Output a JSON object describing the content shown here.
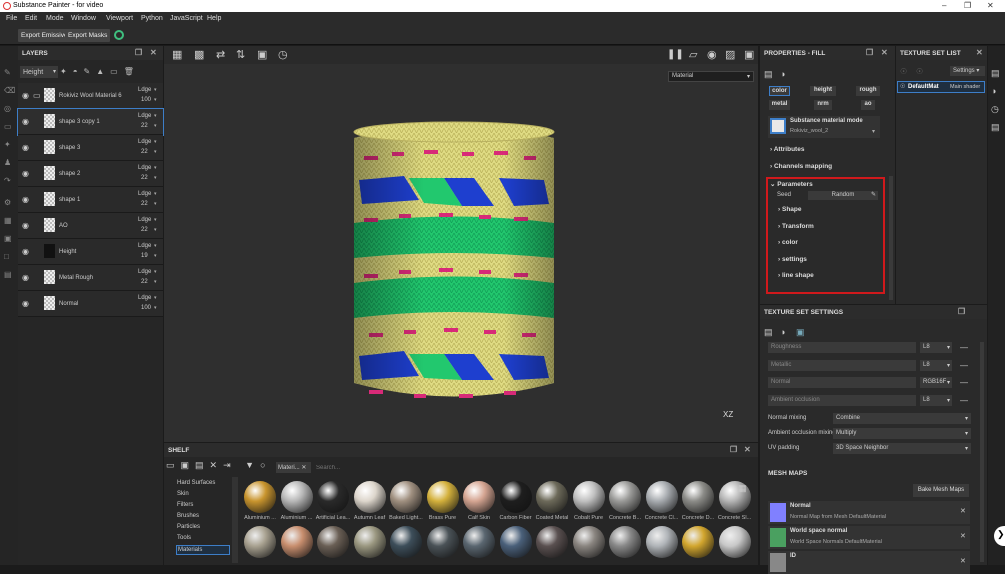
{
  "window": {
    "title": "Substance Painter - for video"
  },
  "menu": [
    "File",
    "Edit",
    "Mode",
    "Window",
    "Viewport",
    "Python",
    "JavaScript",
    "Help"
  ],
  "toolbar": {
    "export_emissive": "Export Emissive",
    "export_masks": "Export Masks"
  },
  "layers": {
    "title": "LAYERS",
    "channel_select": "Height",
    "items": [
      {
        "name": "Rokiviz Wool Material 6",
        "blend": "Ldge",
        "opacity": "100"
      },
      {
        "name": "shape 3 copy 1",
        "blend": "Ldge",
        "opacity": "22"
      },
      {
        "name": "shape 3",
        "blend": "Ldge",
        "opacity": "22"
      },
      {
        "name": "shape 2",
        "blend": "Ldge",
        "opacity": "22"
      },
      {
        "name": "shape 1",
        "blend": "Ldge",
        "opacity": "22"
      },
      {
        "name": "AO",
        "blend": "Ldge",
        "opacity": "22"
      },
      {
        "name": "Height",
        "blend": "Ldge",
        "opacity": "19"
      },
      {
        "name": "Metal Rough",
        "blend": "Ldge",
        "opacity": "22"
      },
      {
        "name": "Normal",
        "blend": "Ldge",
        "opacity": "100"
      }
    ]
  },
  "viewport": {
    "mode": "Material",
    "gizmo": "XZ"
  },
  "properties": {
    "title": "PROPERTIES - FILL",
    "channels": [
      "color",
      "height",
      "rough",
      "metal",
      "nrm",
      "ao"
    ],
    "material_mode": "Substance material mode",
    "material_name": "Rokiviz_wool_2",
    "sections": [
      "Attributes",
      "Channels mapping"
    ],
    "parameters": "Parameters",
    "seed_label": "Seed",
    "seed_value": "Random",
    "groups": [
      "Shape",
      "Transform",
      "color",
      "settings",
      "line shape"
    ]
  },
  "texture_set_list": {
    "title": "TEXTURE SET LIST",
    "settings": "Settings",
    "item": "DefaultMat",
    "shader": "Main shader"
  },
  "tss": {
    "title": "TEXTURE SET SETTINGS",
    "channels": [
      {
        "name": "Roughness",
        "format": "L8"
      },
      {
        "name": "Metallic",
        "format": "L8"
      },
      {
        "name": "Normal",
        "format": "RGB16F"
      },
      {
        "name": "Ambient occlusion",
        "format": "L8"
      }
    ],
    "normal_mixing_label": "Normal mixing",
    "normal_mixing": "Combine",
    "ao_mixing_label": "Ambient occlusion mixing",
    "ao_mixing": "Multiply",
    "uv_padding_label": "UV padding",
    "uv_padding": "3D Space Neighbor",
    "mesh_maps": "MESH MAPS",
    "bake_button": "Bake Mesh Maps",
    "maps": [
      {
        "name": "Normal",
        "desc": "Normal Map from Mesh DefaultMaterial",
        "color": "#8080ff"
      },
      {
        "name": "World space normal",
        "desc": "World Space Normals DefaultMaterial",
        "color": "#4aa060"
      },
      {
        "name": "ID",
        "desc": "",
        "color": "#888888"
      }
    ]
  },
  "shelf": {
    "title": "SHELF",
    "filter_tag": "Materi...",
    "search_placeholder": "Search...",
    "categories": [
      "Hard Surfaces",
      "Skin",
      "Filters",
      "Brushes",
      "Particles",
      "Tools",
      "Materials"
    ],
    "row1": [
      {
        "name": "Aluminium ...",
        "color": "#c9952e"
      },
      {
        "name": "Aluminium ...",
        "color": "#b8b8b8"
      },
      {
        "name": "Artificial Lea...",
        "color": "#2a2a2a"
      },
      {
        "name": "Autumn Leaf",
        "color": "#ddd6cc"
      },
      {
        "name": "Baked Light...",
        "color": "#a09080"
      },
      {
        "name": "Brass Pure",
        "color": "#d4b13c"
      },
      {
        "name": "Calf Skin",
        "color": "#d5a592"
      },
      {
        "name": "Carbon Fiber",
        "color": "#1e1e1e"
      },
      {
        "name": "Coated Metal",
        "color": "#6d6a5a"
      },
      {
        "name": "Cobalt Pure",
        "color": "#c0c0c0"
      },
      {
        "name": "Concrete B...",
        "color": "#9a9a98"
      },
      {
        "name": "Concrete Cl...",
        "color": "#a8acb0"
      },
      {
        "name": "Concrete D...",
        "color": "#8c8c88"
      },
      {
        "name": "Concrete Sl...",
        "color": "#b5b5b5"
      }
    ],
    "row2": [
      {
        "color": "#a8a190"
      },
      {
        "color": "#c88e6e"
      },
      {
        "color": "#6a5f55"
      },
      {
        "color": "#9a9780"
      },
      {
        "color": "#3d4e5a"
      },
      {
        "color": "#4a5257"
      },
      {
        "color": "#5a6670"
      },
      {
        "color": "#4a607a"
      },
      {
        "color": "#5a5050"
      },
      {
        "color": "#8a8580"
      },
      {
        "color": "#888"
      },
      {
        "color": "#b0b4b8"
      },
      {
        "color": "#d2a62e"
      },
      {
        "color": "#c8c8c8"
      }
    ]
  }
}
